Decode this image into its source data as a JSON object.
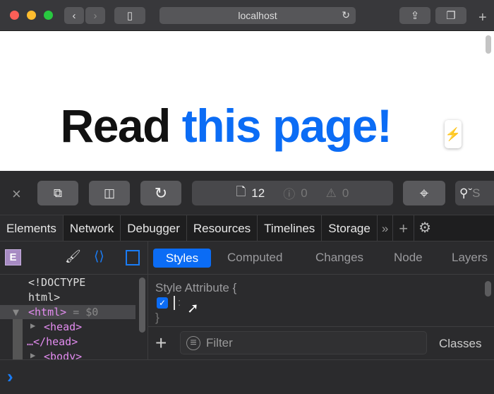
{
  "browser": {
    "url": "localhost"
  },
  "page": {
    "heading_black": "Read ",
    "heading_blue": "this page!"
  },
  "toolbar": {
    "resources_count": "12",
    "errors_count": "0",
    "warnings_count": "0",
    "search_hint": "S"
  },
  "tabs": [
    "Elements",
    "Network",
    "Debugger",
    "Resources",
    "Timelines",
    "Storage"
  ],
  "overflow": "»",
  "dom": {
    "doctype1": "<!DOCTYPE",
    "doctype2": "html>",
    "html": "<html>",
    "eq": " = $0",
    "head": "<head>",
    "head_close": "…</head>",
    "body": "<body>"
  },
  "sidebar": {
    "tabs": [
      "Styles",
      "Computed",
      "Changes",
      "Node",
      "Layers"
    ],
    "style_attr": "Style Attribute",
    "brace_open": "{",
    "brace_close": "}",
    "colon": ":",
    "filter_placeholder": "Filter",
    "classes": "Classes"
  },
  "element_badge": "E",
  "console_prompt": "›",
  "colors": {
    "accent": "#0b6cf5",
    "tag": "#e38cf0"
  }
}
